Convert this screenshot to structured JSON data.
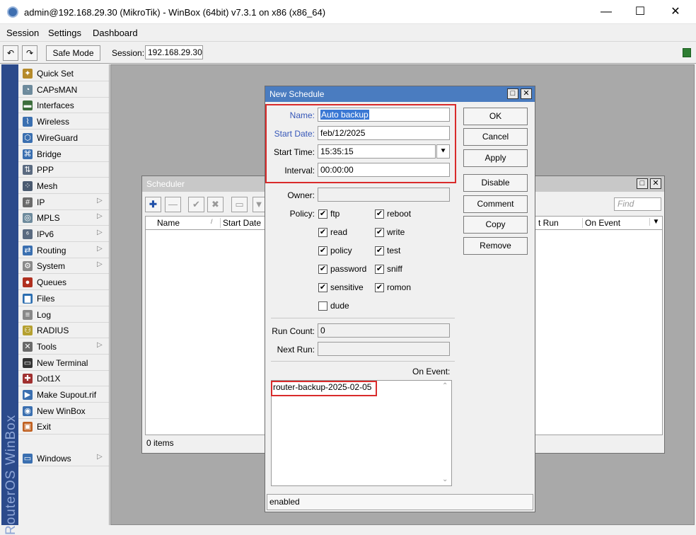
{
  "window": {
    "title": "admin@192.168.29.30 (MikroTik) - WinBox (64bit) v7.3.1 on x86 (x86_64)",
    "minimize": "—",
    "maximize": "☐",
    "close": "✕"
  },
  "menu": [
    "Session",
    "Settings",
    "Dashboard"
  ],
  "toolbar": {
    "undo": "↶",
    "redo": "↷",
    "safe_mode": "Safe Mode",
    "session_label": "Session:",
    "session_value": "192.168.29.30"
  },
  "brand": "RouterOS WinBox",
  "sidebar": [
    {
      "label": "Quick Set",
      "icon": "magic-wand-icon",
      "sub": false
    },
    {
      "label": "CAPsMAN",
      "icon": "capsman-icon",
      "sub": false
    },
    {
      "label": "Interfaces",
      "icon": "interfaces-icon",
      "sub": false
    },
    {
      "label": "Wireless",
      "icon": "wireless-icon",
      "sub": false
    },
    {
      "label": "WireGuard",
      "icon": "wireguard-icon",
      "sub": false
    },
    {
      "label": "Bridge",
      "icon": "bridge-icon",
      "sub": false
    },
    {
      "label": "PPP",
      "icon": "ppp-icon",
      "sub": false
    },
    {
      "label": "Mesh",
      "icon": "mesh-icon",
      "sub": false
    },
    {
      "label": "IP",
      "icon": "ip-icon",
      "sub": true
    },
    {
      "label": "MPLS",
      "icon": "mpls-icon",
      "sub": true
    },
    {
      "label": "IPv6",
      "icon": "ipv6-icon",
      "sub": true
    },
    {
      "label": "Routing",
      "icon": "routing-icon",
      "sub": true
    },
    {
      "label": "System",
      "icon": "gear-icon",
      "sub": true
    },
    {
      "label": "Queues",
      "icon": "queues-icon",
      "sub": false
    },
    {
      "label": "Files",
      "icon": "folder-icon",
      "sub": false
    },
    {
      "label": "Log",
      "icon": "log-icon",
      "sub": false
    },
    {
      "label": "RADIUS",
      "icon": "radius-icon",
      "sub": false
    },
    {
      "label": "Tools",
      "icon": "tools-icon",
      "sub": true
    },
    {
      "label": "New Terminal",
      "icon": "terminal-icon",
      "sub": false
    },
    {
      "label": "Dot1X",
      "icon": "dot1x-icon",
      "sub": false
    },
    {
      "label": "Make Supout.rif",
      "icon": "supout-icon",
      "sub": false
    },
    {
      "label": "New WinBox",
      "icon": "winbox-icon",
      "sub": false
    },
    {
      "label": "Exit",
      "icon": "exit-icon",
      "sub": false
    },
    {
      "label": "Windows",
      "icon": "windows-icon",
      "sub": true
    }
  ],
  "scheduler": {
    "title": "Scheduler",
    "find_placeholder": "Find",
    "columns": [
      "Name",
      "Start Date",
      "t Run",
      "On Event"
    ],
    "status": "0 items"
  },
  "dialog": {
    "title": "New Schedule",
    "fields": {
      "name_label": "Name:",
      "name_value": "Auto backup",
      "start_date_label": "Start Date:",
      "start_date_value": "feb/12/2025",
      "start_time_label": "Start Time:",
      "start_time_value": "15:35:15",
      "interval_label": "Interval:",
      "interval_value": "00:00:00",
      "owner_label": "Owner:",
      "owner_value": "",
      "policy_label": "Policy:",
      "run_count_label": "Run Count:",
      "run_count_value": "0",
      "next_run_label": "Next Run:",
      "next_run_value": "",
      "on_event_label": "On Event:",
      "on_event_value": "router-backup-2025-02-05"
    },
    "policies": [
      {
        "label": "ftp",
        "checked": true
      },
      {
        "label": "reboot",
        "checked": true
      },
      {
        "label": "read",
        "checked": true
      },
      {
        "label": "write",
        "checked": true
      },
      {
        "label": "policy",
        "checked": true
      },
      {
        "label": "test",
        "checked": true
      },
      {
        "label": "password",
        "checked": true
      },
      {
        "label": "sniff",
        "checked": true
      },
      {
        "label": "sensitive",
        "checked": true
      },
      {
        "label": "romon",
        "checked": true
      },
      {
        "label": "dude",
        "checked": false
      }
    ],
    "buttons": [
      "OK",
      "Cancel",
      "Apply",
      "Disable",
      "Comment",
      "Copy",
      "Remove"
    ],
    "status": "enabled"
  },
  "colors": {
    "highlight": "#d92b2b",
    "title_active": "#4a7cc0",
    "brand_strip": "#2b4a8b"
  }
}
